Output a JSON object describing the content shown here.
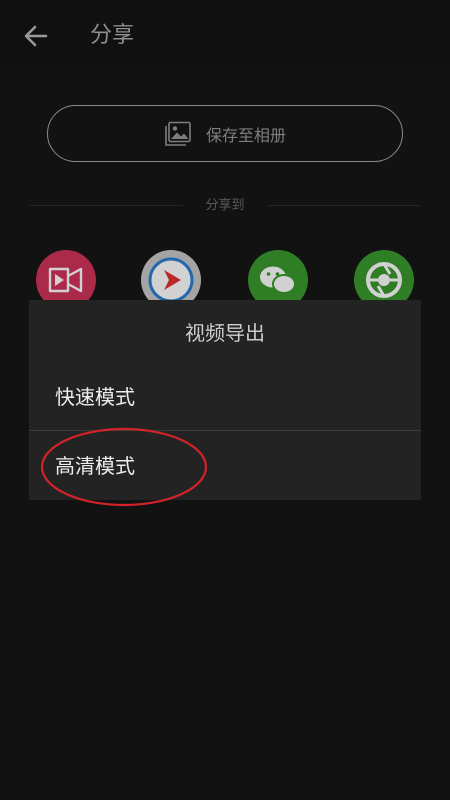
{
  "header": {
    "title": "分享",
    "back_icon": "arrow-left-icon"
  },
  "save": {
    "label": "保存至相册",
    "icon": "photo-album-icon"
  },
  "share_section": {
    "label": "分享到",
    "targets": [
      {
        "icon": "video-camera-icon",
        "color": "#d1345b"
      },
      {
        "icon": "play-circle-icon",
        "color": "#c9c9c9"
      },
      {
        "icon": "wechat-icon",
        "color": "#3a9a2f"
      },
      {
        "icon": "moments-aperture-icon",
        "color": "#3a9a2f"
      }
    ]
  },
  "dialog": {
    "title": "视频导出",
    "options": [
      {
        "label": "快速模式"
      },
      {
        "label": "高清模式"
      }
    ]
  },
  "annotation": {
    "highlight_color": "#d2232a"
  }
}
